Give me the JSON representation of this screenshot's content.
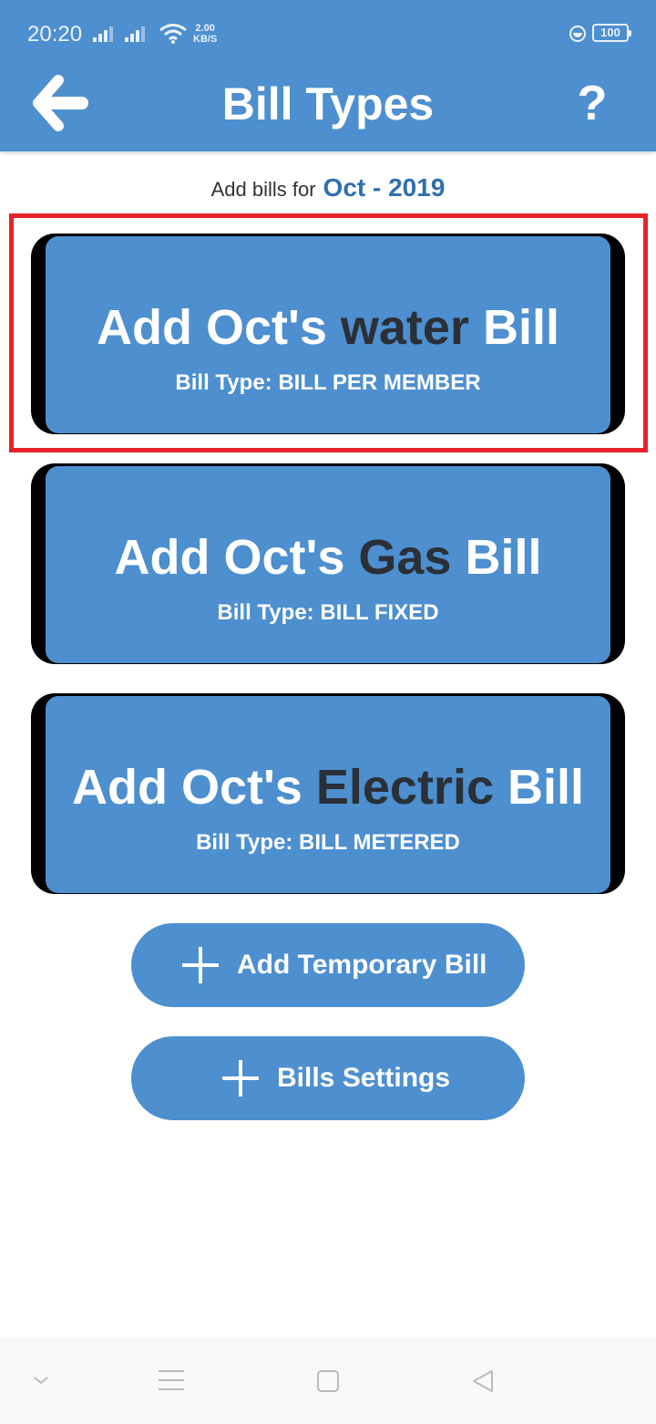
{
  "status_bar": {
    "time": "20:20",
    "net_speed_value": "2.00",
    "net_speed_unit": "KB/S",
    "battery": "100"
  },
  "header": {
    "title": "Bill Types",
    "help_label": "?"
  },
  "period": {
    "prefix": "Add bills for",
    "month": "Oct - 2019"
  },
  "bills": [
    {
      "prefix": "Add Oct's",
      "type": "water",
      "suffix": "Bill",
      "bill_type": "Bill Type: BILL PER MEMBER"
    },
    {
      "prefix": "Add Oct's",
      "type": "Gas",
      "suffix": "Bill",
      "bill_type": "Bill Type: BILL FIXED"
    },
    {
      "prefix": "Add Oct's",
      "type": "Electric",
      "suffix": "Bill",
      "bill_type": "Bill Type: BILL METERED"
    }
  ],
  "actions": {
    "add_temporary": "Add Temporary Bill",
    "settings": "Bills Settings"
  },
  "colors": {
    "primary": "#4d8fcf",
    "highlight": "#e8222a",
    "type_text": "#2b2f36",
    "month_text": "#2f6fae"
  },
  "icons": [
    "back-arrow-icon",
    "help-icon",
    "plus-icon",
    "signal-icon",
    "wifi-icon",
    "battery-icon"
  ]
}
